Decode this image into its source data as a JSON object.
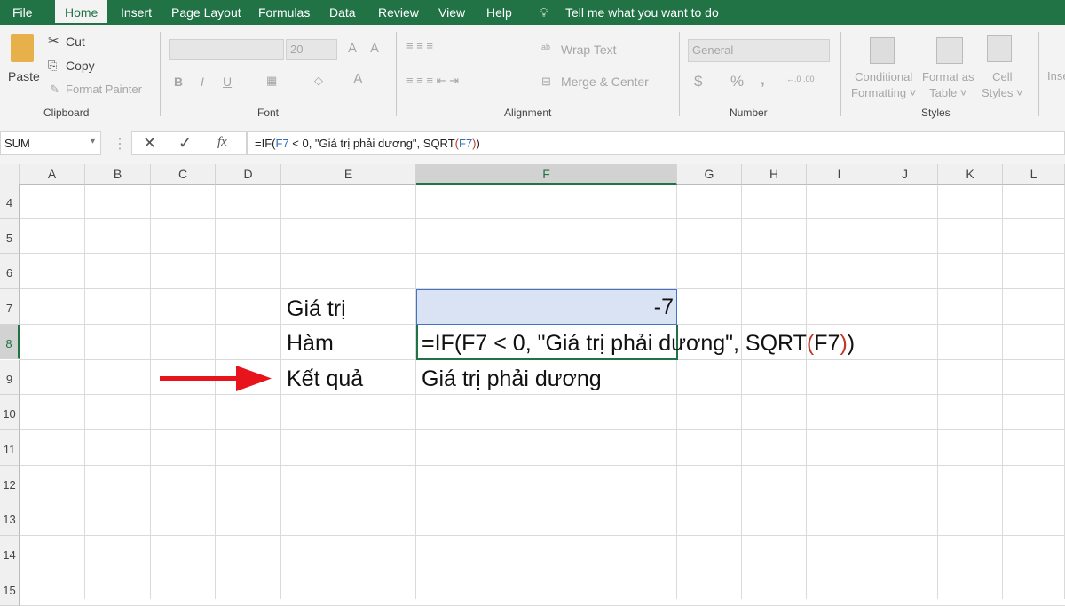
{
  "tabs": [
    "File",
    "Home",
    "Insert",
    "Page Layout",
    "Formulas",
    "Data",
    "Review",
    "View",
    "Help"
  ],
  "tell_me": "Tell me what you want to do",
  "ribbon": {
    "clipboard": {
      "paste": "Paste",
      "cut": "Cut",
      "copy": "Copy",
      "format_painter": "Format Painter",
      "label": "Clipboard"
    },
    "font": {
      "size": "20",
      "label": "Font",
      "bold": "B",
      "italic": "I",
      "underline": "U",
      "font_color": "A"
    },
    "alignment": {
      "wrap_text": "Wrap Text",
      "merge_center": "Merge & Center",
      "label": "Alignment"
    },
    "number": {
      "format": "General",
      "currency": "$",
      "percent": "%",
      "comma": ",",
      "label": "Number"
    },
    "styles": {
      "conditional_1": "Conditional",
      "conditional_2": "Formatting",
      "format_table_1": "Format as",
      "format_table_2": "Table",
      "cell_styles_1": "Cell",
      "cell_styles_2": "Styles",
      "label": "Styles"
    },
    "insert": "Inse"
  },
  "formula_bar": {
    "name_box": "SUM",
    "fx": "fx",
    "formula": {
      "p1": "=IF(",
      "ref1": "F7",
      "p2": " < 0, \"Giá trị phải dương\", SQRT",
      "paren_open": "(",
      "ref2": "F7",
      "paren_close": ")",
      "p3": ")"
    }
  },
  "columns": [
    "A",
    "B",
    "C",
    "D",
    "E",
    "F",
    "G",
    "H",
    "I",
    "J",
    "K",
    "L"
  ],
  "rows": [
    "4",
    "5",
    "6",
    "7",
    "8",
    "9",
    "10",
    "11",
    "12",
    "13",
    "14",
    "15"
  ],
  "cells": {
    "E7": "Giá trị",
    "F7": "-7",
    "E8": "Hàm",
    "E9": "Kết quả",
    "F9": "Giá trị phải dương"
  },
  "edit": {
    "p1": "=IF(F7 < 0, \"Giá trị phải dương\", SQRT",
    "open": "(",
    "ref": "F7",
    "close": ")",
    "p2": ")"
  },
  "colors": {
    "accent": "#217346",
    "arrow": "#e8141b",
    "selection": "#d9e3f3",
    "ref_blue": "#2f6eba"
  }
}
